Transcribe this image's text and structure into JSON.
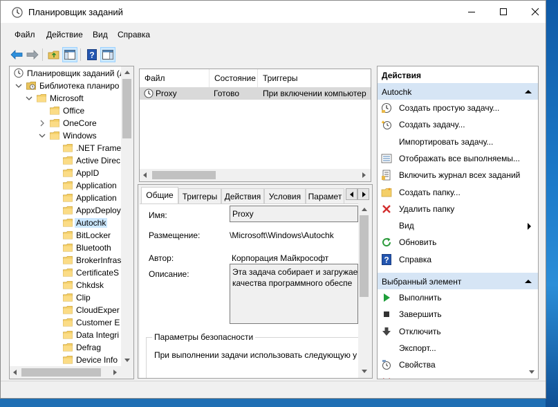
{
  "window": {
    "title": "Планировщик заданий"
  },
  "menu": [
    "Файл",
    "Действие",
    "Вид",
    "Справка"
  ],
  "tree": {
    "items": [
      {
        "label": "Планировщик заданий (Л",
        "level": 0,
        "expander": "none",
        "icon": "clock-icon"
      },
      {
        "label": "Библиотека планиро",
        "level": 1,
        "expander": "open",
        "icon": "library-folder-icon"
      },
      {
        "label": "Microsoft",
        "level": 2,
        "expander": "open",
        "icon": "folder-icon"
      },
      {
        "label": "Office",
        "level": 3,
        "expander": "none",
        "icon": "folder-icon"
      },
      {
        "label": "OneCore",
        "level": 3,
        "expander": "closed",
        "icon": "folder-icon"
      },
      {
        "label": "Windows",
        "level": 3,
        "expander": "open",
        "icon": "folder-icon"
      },
      {
        "label": ".NET Frame",
        "level": 4,
        "expander": "none",
        "icon": "folder-icon"
      },
      {
        "label": "Active Direc",
        "level": 4,
        "expander": "none",
        "icon": "folder-icon"
      },
      {
        "label": "AppID",
        "level": 4,
        "expander": "none",
        "icon": "folder-icon"
      },
      {
        "label": "Application",
        "level": 4,
        "expander": "none",
        "icon": "folder-icon"
      },
      {
        "label": "Application",
        "level": 4,
        "expander": "none",
        "icon": "folder-icon"
      },
      {
        "label": "AppxDeploy",
        "level": 4,
        "expander": "none",
        "icon": "folder-icon"
      },
      {
        "label": "Autochk",
        "level": 4,
        "expander": "none",
        "icon": "folder-icon",
        "selected": true
      },
      {
        "label": "BitLocker",
        "level": 4,
        "expander": "none",
        "icon": "folder-icon"
      },
      {
        "label": "Bluetooth",
        "level": 4,
        "expander": "none",
        "icon": "folder-icon"
      },
      {
        "label": "BrokerInfras",
        "level": 4,
        "expander": "none",
        "icon": "folder-icon"
      },
      {
        "label": "CertificateS",
        "level": 4,
        "expander": "none",
        "icon": "folder-icon"
      },
      {
        "label": "Chkdsk",
        "level": 4,
        "expander": "none",
        "icon": "folder-icon"
      },
      {
        "label": "Clip",
        "level": 4,
        "expander": "none",
        "icon": "folder-icon"
      },
      {
        "label": "CloudExper",
        "level": 4,
        "expander": "none",
        "icon": "folder-icon"
      },
      {
        "label": "Customer E",
        "level": 4,
        "expander": "none",
        "icon": "folder-icon"
      },
      {
        "label": "Data Integri",
        "level": 4,
        "expander": "none",
        "icon": "folder-icon"
      },
      {
        "label": "Defrag",
        "level": 4,
        "expander": "none",
        "icon": "folder-icon"
      },
      {
        "label": "Device Info",
        "level": 4,
        "expander": "none",
        "icon": "folder-icon"
      }
    ]
  },
  "task_list": {
    "columns": [
      "Файл",
      "Состояние",
      "Триггеры"
    ],
    "rows": [
      {
        "name": "Proxy",
        "status": "Готово",
        "triggers": "При включении компьютер"
      }
    ]
  },
  "details": {
    "tabs": [
      "Общие",
      "Триггеры",
      "Действия",
      "Условия",
      "Парамет"
    ],
    "active_tab": "Общие",
    "name_label": "Имя:",
    "name_value": "Proxy",
    "location_label": "Размещение:",
    "location_value": "\\Microsoft\\Windows\\Autochk",
    "author_label": "Автор:",
    "author_value": "Корпорация Майкрософт",
    "description_label": "Описание:",
    "description_line1": "Эта задача собирает и загружает",
    "description_line2": "качества программного обеспе",
    "security_group": "Параметры безопасности",
    "security_text": "При выполнении задачи использовать следующую у"
  },
  "actions": {
    "header": "Действия",
    "group1": {
      "title": "Autochk",
      "items": [
        {
          "label": "Создать простую задачу...",
          "icon": "wizard-clock-icon"
        },
        {
          "label": "Создать задачу...",
          "icon": "new-task-icon"
        },
        {
          "label": "Импортировать задачу...",
          "icon": ""
        },
        {
          "label": "Отображать все выполняемы...",
          "icon": "running-list-icon"
        },
        {
          "label": "Включить журнал всех заданий",
          "icon": "journal-icon"
        },
        {
          "label": "Создать папку...",
          "icon": "new-folder-icon"
        },
        {
          "label": "Удалить папку",
          "icon": "delete-x-icon"
        },
        {
          "label": "Вид",
          "icon": "",
          "submenu": true
        },
        {
          "label": "Обновить",
          "icon": "refresh-icon"
        },
        {
          "label": "Справка",
          "icon": "help-icon"
        }
      ]
    },
    "group2": {
      "title": "Выбранный элемент",
      "items": [
        {
          "label": "Выполнить",
          "icon": "run-icon"
        },
        {
          "label": "Завершить",
          "icon": "stop-icon"
        },
        {
          "label": "Отключить",
          "icon": "disable-icon"
        },
        {
          "label": "Экспорт...",
          "icon": ""
        },
        {
          "label": "Свойства",
          "icon": "properties-icon"
        },
        {
          "label": "У",
          "icon": "delete-x-icon"
        }
      ]
    }
  },
  "colors": {
    "accent": "#0078d7",
    "selection": "#cce8ff",
    "group_header": "#d6e5f5"
  }
}
